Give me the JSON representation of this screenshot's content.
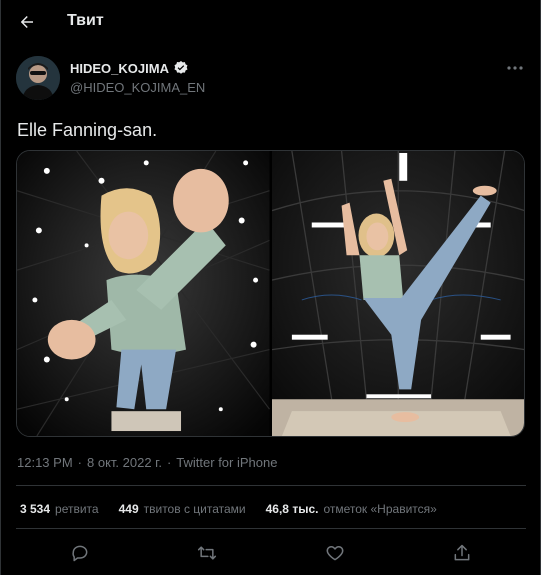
{
  "header": {
    "title": "Твит",
    "back_icon": "arrow-left-icon"
  },
  "author": {
    "name": "HIDEO_KOJIMA",
    "handle": "@HIDEO_KOJIMA_EN",
    "verified_icon": "verified-badge-icon",
    "avatar_icon": "avatar"
  },
  "more_icon": "ellipsis-icon",
  "tweet": {
    "text": "Elle Fanning-san."
  },
  "media": {
    "count": 2
  },
  "meta": {
    "time": "12:13 PM",
    "dot1": "·",
    "date": "8 окт. 2022 г.",
    "dot2": "·",
    "source": "Twitter for iPhone"
  },
  "stats": [
    {
      "count": "3 534",
      "label": "ретвита"
    },
    {
      "count": "449",
      "label": "твитов с цитатами"
    },
    {
      "count": "46,8 тыс.",
      "label": "отметок «Нравится»"
    }
  ],
  "actions": [
    "reply-icon",
    "retweet-icon",
    "like-icon",
    "share-icon"
  ],
  "colors": {
    "background": "#000000",
    "text": "#e7e9ea",
    "secondary": "#71767b",
    "border": "#2f3336"
  }
}
